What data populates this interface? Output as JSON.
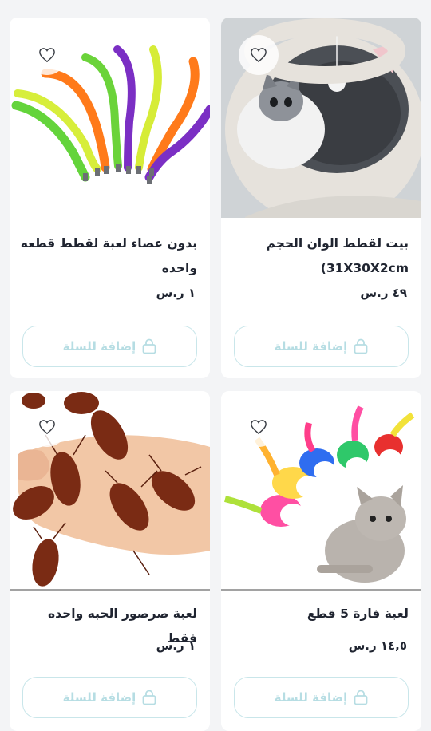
{
  "products": [
    {
      "title": "بيت لقطط الوان الحجم 31X30X2cm)",
      "price": "٤٩ ر.س",
      "add_to_cart": "إضافة للسلة",
      "icons": {
        "favorite": "heart-outline-icon",
        "cart": "lock-bag-icon"
      }
    },
    {
      "title": "بدون عصاء لعبة لقطط قطعه واحده",
      "price": "١ ر.س",
      "add_to_cart": "إضافة للسلة",
      "icons": {
        "favorite": "heart-outline-icon",
        "cart": "lock-bag-icon"
      }
    },
    {
      "title": "لعبة فارة 5 قطع",
      "price": "١٤,٥ ر.س",
      "add_to_cart": "إضافة للسلة",
      "icons": {
        "favorite": "heart-outline-icon",
        "cart": "lock-bag-icon"
      }
    },
    {
      "title": "لعبة صرصور الحبه واحده فقط",
      "price": "١ ر.س",
      "add_to_cart": "إضافة للسلة",
      "icons": {
        "favorite": "heart-outline-icon",
        "cart": "lock-bag-icon"
      }
    }
  ],
  "colors": {
    "background": "#f3f4f6",
    "card": "#ffffff",
    "button_border": "#c9e6ea",
    "button_text": "#b6dde3",
    "text": "#1f2430"
  }
}
